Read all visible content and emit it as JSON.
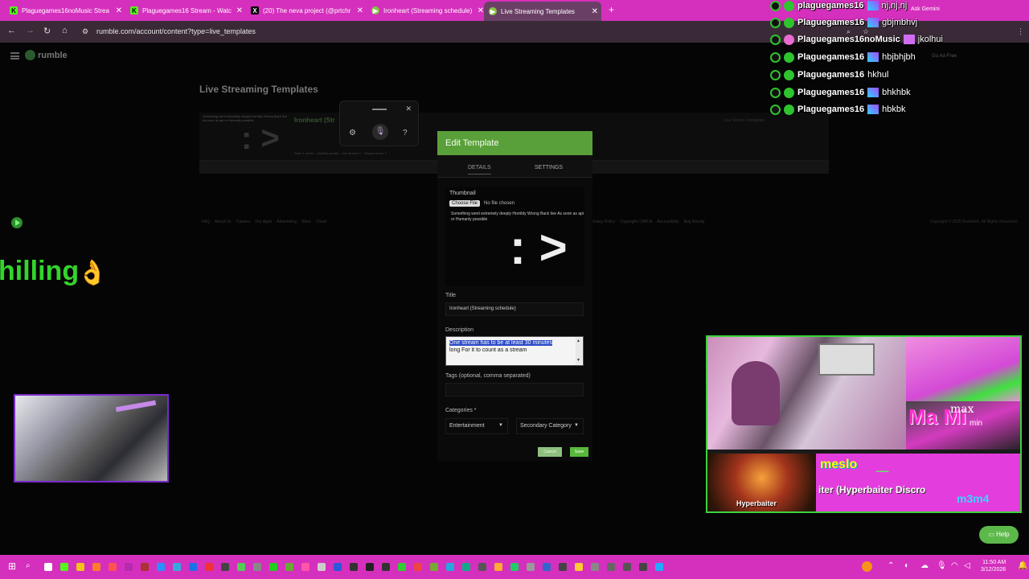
{
  "browser": {
    "tabs": [
      {
        "label": "Plaguegames16noMusic Strea",
        "icon": "kick-icon",
        "color": "#53fc18"
      },
      {
        "label": "Plaguegames16 Stream - Watc",
        "icon": "kick-icon",
        "color": "#53fc18"
      },
      {
        "label": "(20) The neva project (@prtchr",
        "icon": "x-icon",
        "color": "#000000"
      },
      {
        "label": "Ironheart (Streaming schedule)",
        "icon": "rumble-icon",
        "color": "#85c742"
      },
      {
        "label": "Live Streaming Templates",
        "icon": "rumble-icon",
        "color": "#85c742"
      }
    ],
    "url": "rumble.com/account/content?type=live_templates",
    "ask_gemini": "Ask Gemini"
  },
  "site": {
    "logo": "rumble",
    "page_title": "Live Streaming Templates",
    "go_ad_free": "Go Ad-Free",
    "template_row": {
      "thumb_text": "Something went extremely deeply Horribly Wrong Back live As soon as api or Humanly possible",
      "title": "Ironheart (Str",
      "meta": "Save 1 month · visibility private · Live stream 2 · Unique viewer 1",
      "right": "Live Stream Templates"
    },
    "footer_links": [
      "FAQ",
      "About Us",
      "Careers",
      "Our Apps",
      "Advertising",
      "Store",
      "Cloud"
    ],
    "footer_links_2": [
      "Privacy Policy",
      "Copyright / DMCA",
      "Accessibility",
      "Bug Bounty"
    ],
    "copyright": "Copyright © 2026 Rumble®. All Rights Reserved."
  },
  "modal": {
    "title": "Edit Template",
    "tabs": [
      "DETAILS",
      "SETTINGS"
    ],
    "thumbnail_label": "Thumbnail",
    "choose_file": "Choose File",
    "no_file": "No file chosen",
    "thumbnail_desc": "Something went extremely deeply Horribly Wrong Back live As soon as api or Humanly possible",
    "thumbnail_art": ": >",
    "title_label": "Title",
    "title_value": "Ironheart (Streaming schedule)",
    "description_label": "Description",
    "description_selected": "One stream has to be at least 30 minutes",
    "description_rest": "long For it to count as a stream",
    "tags_label": "Tags (optional, comma separated)",
    "tags_value": "",
    "categories_label": "Categories *",
    "primary_category": "Entertainment",
    "secondary_category": "Secondary Category",
    "cancel": "Cancel",
    "save": "Save"
  },
  "overlay": {
    "chilling_text": "hilling",
    "chat": [
      {
        "name": "plaguegames16",
        "avatar": "green",
        "emote": "blue",
        "msg": "nj,nj,nj"
      },
      {
        "name": "Plaguegames16",
        "avatar": "green",
        "emote": "blue",
        "msg": "gbjmbhvj"
      },
      {
        "name": "Plaguegames16noMusic",
        "avatar": "pink",
        "emote": "pink",
        "msg": "jkolhui"
      },
      {
        "name": "Plaguegames16",
        "avatar": "green",
        "emote": "blue",
        "msg": "hbjbhjbh"
      },
      {
        "name": "Plaguegames16",
        "avatar": "green",
        "emote": "none",
        "msg": "hkhul"
      },
      {
        "name": "Plaguegames16",
        "avatar": "green",
        "emote": "blue",
        "msg": "bhkhbk"
      },
      {
        "name": "Plaguegames16",
        "avatar": "green",
        "emote": "blue",
        "msg": "hbkbk"
      }
    ],
    "collage": {
      "max": "max",
      "min": "min",
      "mami": "Ma  Mi",
      "hyperbaiter": "Hyperbaiter",
      "meslo": "meslo",
      "hb_disc": "iter (Hyperbaiter Discro",
      "m3m4": "m3m4"
    },
    "help": "Help"
  },
  "taskbar": {
    "time": "11:50 AM",
    "date": "3/12/2026"
  },
  "colors": {
    "rumble_green": "#85c742",
    "modal_header": "#5aa03a",
    "tabbar": "#d52fbd",
    "overlay_green": "#34d42c"
  }
}
